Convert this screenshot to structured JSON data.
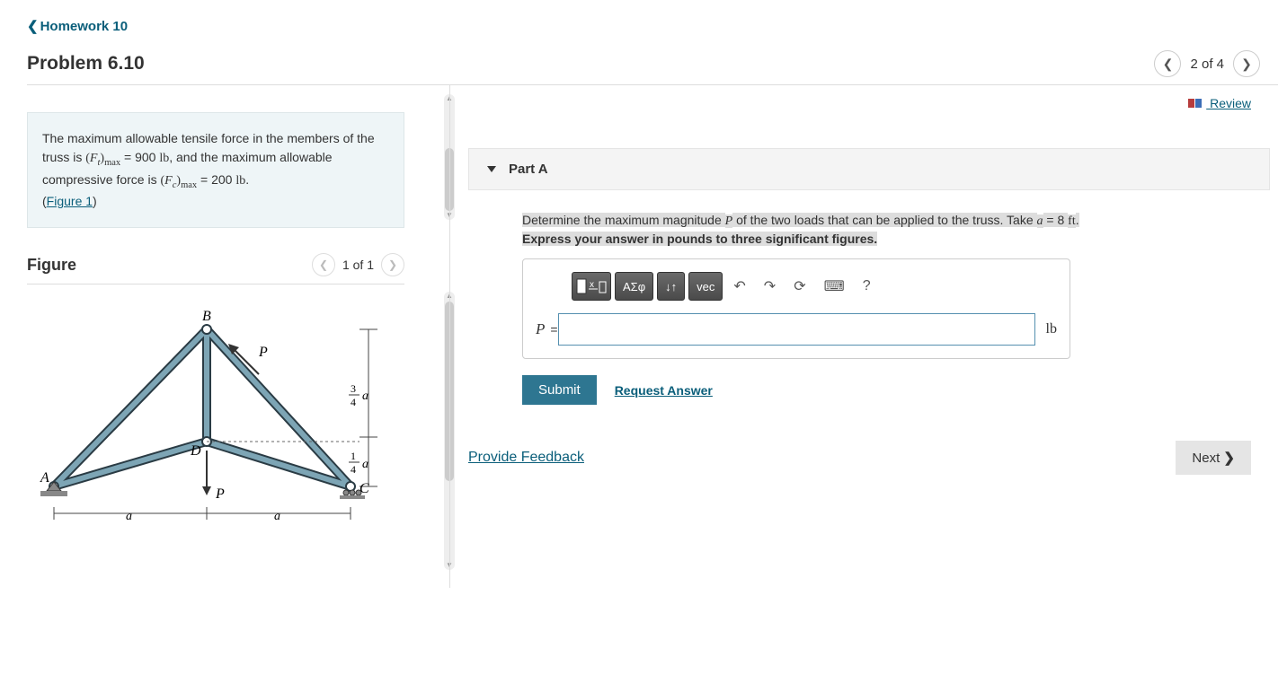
{
  "breadcrumb": "Homework 10",
  "problem_title": "Problem 6.10",
  "nav": {
    "position": "2 of 4"
  },
  "description": {
    "text1": "The maximum allowable tensile force in the members of the truss is ",
    "ft_var": "F",
    "ft_sub": "t",
    "max_sub": "max",
    "eq1": " = 900 ",
    "unit_lb": "lb",
    "text2": ", and the maximum allowable compressive force is ",
    "fc_var": "F",
    "fc_sub": "c",
    "eq2": " = 200 ",
    "period": ".",
    "figure_link": "Figure 1"
  },
  "figure": {
    "label": "Figure",
    "nav": "1 of 1",
    "labels": {
      "A": "A",
      "B": "B",
      "C": "C",
      "D": "D",
      "P": "P",
      "a": "a",
      "frac3_4": "¾",
      "frac1_4": "¼"
    }
  },
  "review_label": " Review",
  "part": {
    "label": "Part A",
    "q_text1": "Determine the maximum magnitude ",
    "q_var_P": "P",
    "q_text2": " of the two loads that can be applied to the truss. Take ",
    "q_var_a": "a",
    "q_text3": " = 8 ",
    "q_unit_ft": "ft",
    "q_text4": ".",
    "instruction": "Express your answer in pounds to three significant figures.",
    "toolbar": {
      "templates_sym": "√",
      "greek": "ΑΣφ",
      "sort": "↓↑",
      "vec": "vec",
      "undo": "↶",
      "redo": "↷",
      "reset": "⟳",
      "keyboard": "⌨",
      "help": "?"
    },
    "answer_var": "P",
    "answer_eq": " = ",
    "answer_unit": "lb",
    "submit": "Submit",
    "request": "Request Answer"
  },
  "feedback": "Provide Feedback",
  "next": "Next"
}
